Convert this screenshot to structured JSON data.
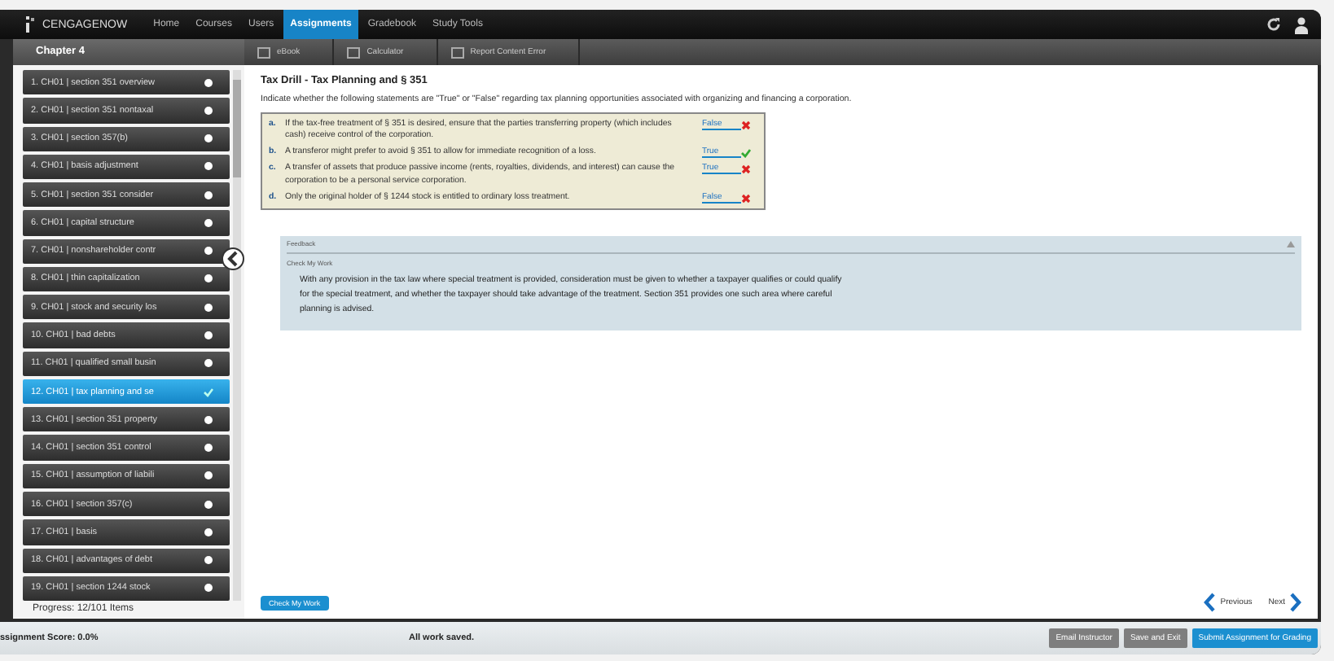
{
  "nav": {
    "logo": "CENGAGENOW",
    "items": [
      {
        "label": "Home",
        "selected": false
      },
      {
        "label": "Courses",
        "selected": false
      },
      {
        "label": "Users",
        "selected": false
      },
      {
        "label": "Assignments",
        "selected": true
      },
      {
        "label": "Gradebook",
        "selected": false
      },
      {
        "label": "Study Tools",
        "selected": false
      }
    ]
  },
  "sidebar": {
    "title": "Chapter 4",
    "items": [
      {
        "label": "1. CH01 | section 351 overview",
        "selected": false
      },
      {
        "label": "2. CH01 | section 351 nontaxal",
        "selected": false
      },
      {
        "label": "3. CH01 | section 357(b)",
        "selected": false
      },
      {
        "label": "4. CH01 | basis adjustment",
        "selected": false
      },
      {
        "label": "5. CH01 | section 351 consider",
        "selected": false
      },
      {
        "label": "6. CH01 | capital structure",
        "selected": false
      },
      {
        "label": "7. CH01 | nonshareholder contr",
        "selected": false
      },
      {
        "label": "8. CH01 | thin capitalization",
        "selected": false
      },
      {
        "label": "9. CH01 | stock and security los",
        "selected": false
      },
      {
        "label": "10. CH01 | bad debts",
        "selected": false
      },
      {
        "label": "11. CH01 | qualified small busin",
        "selected": false
      },
      {
        "label": "12. CH01 | tax planning and se",
        "selected": true
      },
      {
        "label": "13. CH01 | section 351 property",
        "selected": false
      },
      {
        "label": "14. CH01 | section 351 control",
        "selected": false
      },
      {
        "label": "15. CH01 | assumption of liabili",
        "selected": false
      },
      {
        "label": "16. CH01 | section 357(c)",
        "selected": false
      },
      {
        "label": "17. CH01 | basis",
        "selected": false
      },
      {
        "label": "18. CH01 | advantages of debt",
        "selected": false
      },
      {
        "label": "19. CH01 | section 1244 stock",
        "selected": false
      }
    ],
    "progress": "Progress: 12/101 Items"
  },
  "toolbar": [
    "eBook",
    "Calculator",
    "Report Content Error"
  ],
  "question": {
    "title": "Tax Drill - Tax Planning and § 351",
    "prompt": "Indicate whether the following statements are \"True\" or \"False\" regarding tax planning opportunities associated with organizing and financing a corporation.",
    "statements": [
      {
        "letter": "a.",
        "text": "If the tax-free treatment of § 351 is desired, ensure that the parties transferring property (which includes cash) receive control of the corporation.",
        "answer": "False",
        "correct": false
      },
      {
        "letter": "b.",
        "text": "A transferor might prefer to avoid § 351 to allow for immediate recognition of a loss.",
        "answer": "True",
        "correct": true
      },
      {
        "letter": "c.",
        "text": "A transfer of assets that produce passive income (rents, royalties, dividends, and interest) can cause the corporation to be a personal service corporation.",
        "answer": "True",
        "correct": false
      },
      {
        "letter": "d.",
        "text": "Only the original holder of § 1244 stock is entitled to ordinary loss treatment.",
        "answer": "False",
        "correct": false
      }
    ]
  },
  "feedback": {
    "title": "Feedback",
    "subtitle": "Check My Work",
    "text": "With any provision in the tax law where special treatment is provided, consideration must be given to whether a taxpayer qualifies or could qualify for the special treatment, and whether the taxpayer should take advantage of the treatment. Section 351 provides one such area where careful planning is advised."
  },
  "actions": {
    "check": "Check My Work",
    "previous": "Previous",
    "next": "Next"
  },
  "footer": {
    "score": "ssignment Score: 0.0%",
    "status": "All work saved.",
    "buttons": [
      {
        "label": "Email Instructor",
        "kind": "grey"
      },
      {
        "label": "Save and Exit",
        "kind": "grey"
      },
      {
        "label": "Submit Assignment for Grading",
        "kind": "blue"
      }
    ]
  }
}
